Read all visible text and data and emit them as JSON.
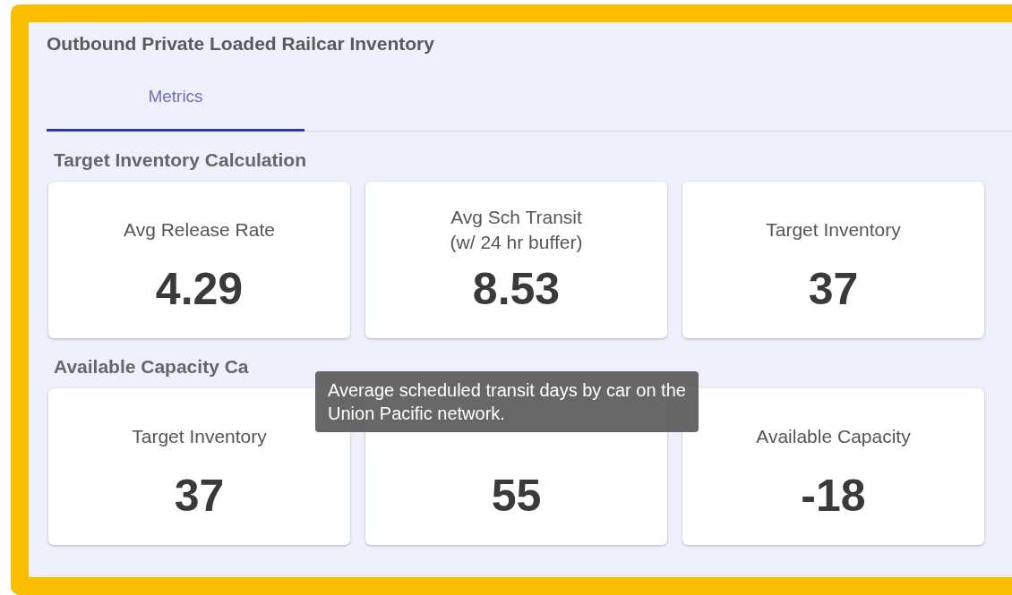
{
  "panel": {
    "title": "Outbound Private Loaded Railcar Inventory"
  },
  "tabs": [
    {
      "label": "Metrics",
      "selected": true
    }
  ],
  "sections": [
    {
      "title": "Target Inventory Calculation",
      "cards": [
        {
          "label": "Avg Release Rate",
          "value": "4.29"
        },
        {
          "label": "Avg Sch Transit\n(w/ 24 hr buffer)",
          "value": "8.53"
        },
        {
          "label": "Target Inventory",
          "value": "37"
        }
      ]
    },
    {
      "title": "Available Capacity Ca",
      "cards": [
        {
          "label": "Target Inventory",
          "value": "37"
        },
        {
          "value": "55"
        },
        {
          "label": "Available Capacity",
          "value": "-18"
        }
      ]
    }
  ],
  "tooltip": {
    "text": "Average scheduled transit days by car on the Union Pacific network."
  }
}
